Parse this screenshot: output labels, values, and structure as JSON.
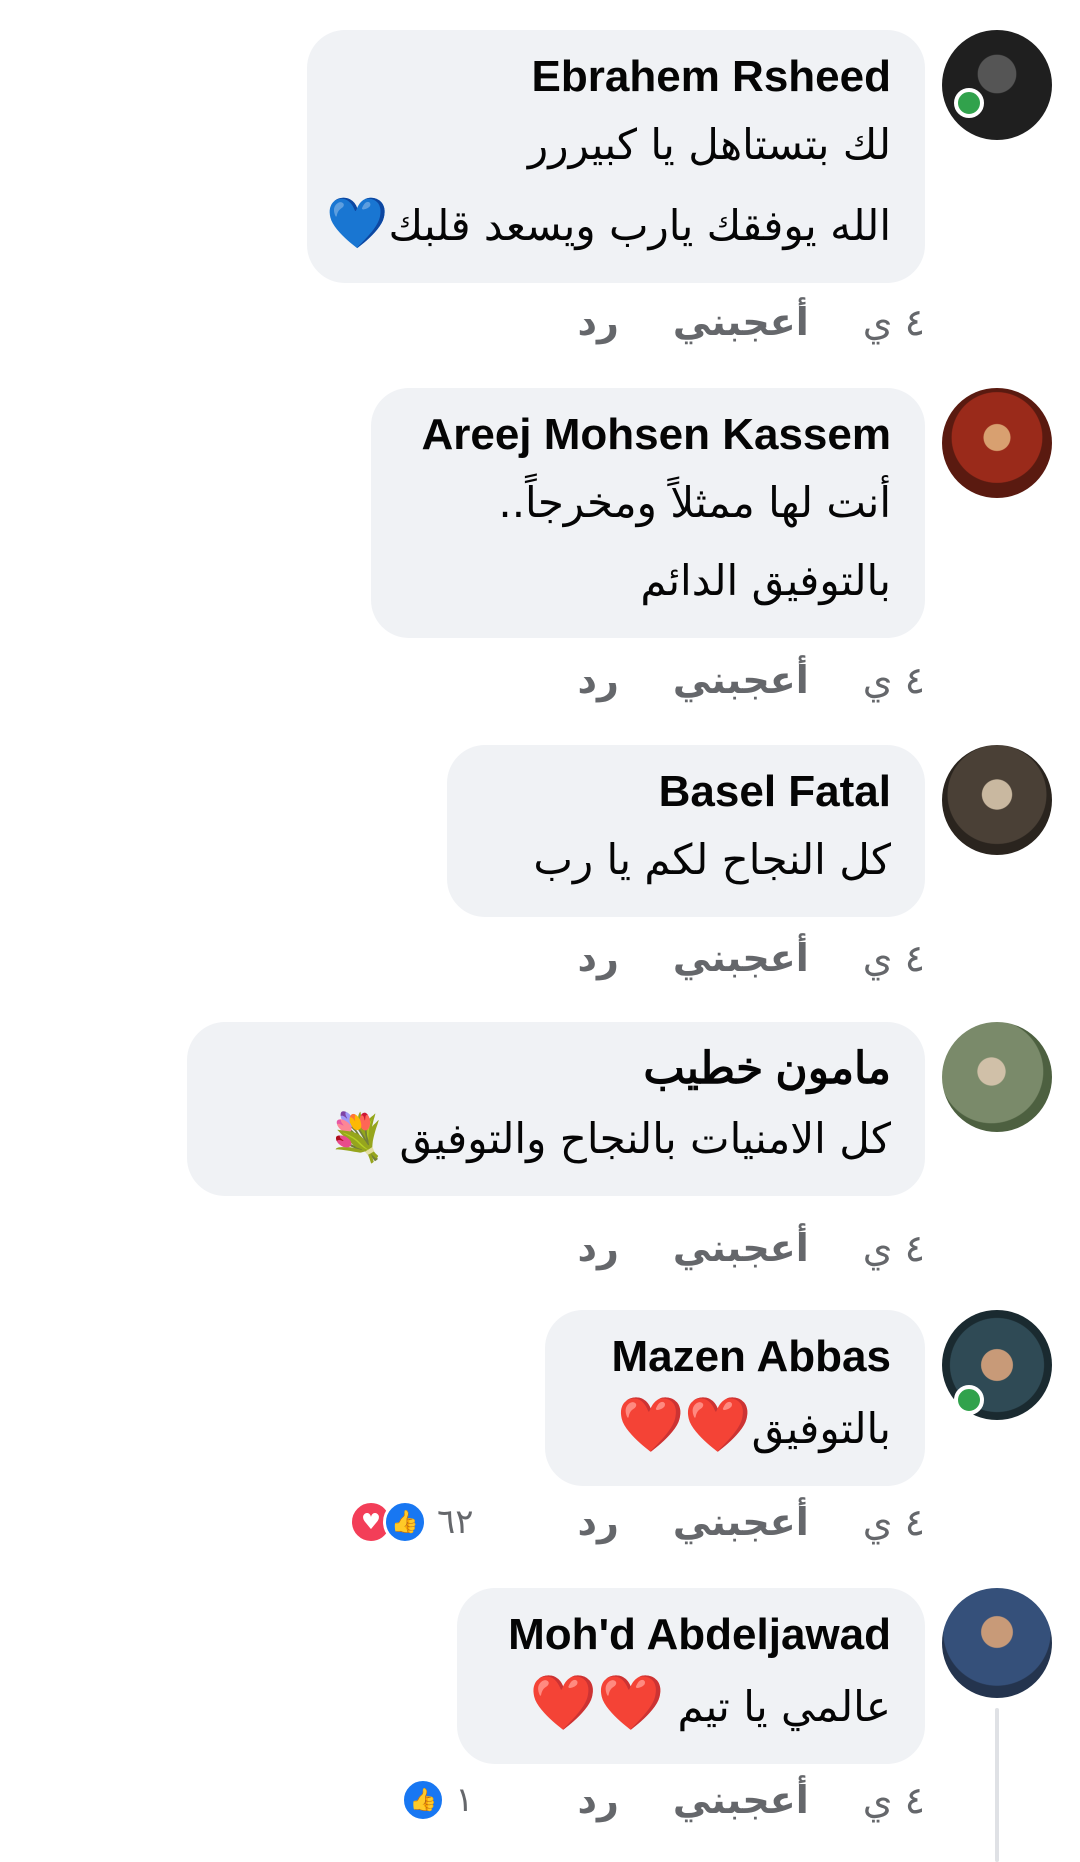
{
  "comments": [
    {
      "name": "Ebrahem Rsheed",
      "lines": [
        "لك بتستاهل يا كبيررر",
        "الله يوفقك يارب ويسعد قلبك"
      ],
      "emoji": "💙",
      "time": "٤ ي",
      "like_label": "أعجبني",
      "reply_label": "رد",
      "online": true,
      "avatar_color": "#2b2b2b"
    },
    {
      "name": "Areej Mohsen Kassem",
      "lines": [
        "أنت لها ممثلاً ومخرجاً..",
        "بالتوفيق الدائم"
      ],
      "time": "٤ ي",
      "like_label": "أعجبني",
      "reply_label": "رد",
      "online": false,
      "avatar_color": "#b23a2a"
    },
    {
      "name": "Basel Fatal",
      "lines": [
        "كل النجاح لكم يا رب"
      ],
      "time": "٤ ي",
      "like_label": "أعجبني",
      "reply_label": "رد",
      "online": false,
      "avatar_color": "#4a4036"
    },
    {
      "name": "مامون خطيب",
      "lines": [
        "كل الامنيات بالنجاح والتوفيق"
      ],
      "emoji": "💐",
      "time": "٤ ي",
      "like_label": "أعجبني",
      "reply_label": "رد",
      "online": false,
      "avatar_color": "#7a8a6a"
    },
    {
      "name": "Mazen Abbas",
      "lines": [
        "بالتوفيق"
      ],
      "emoji": "❤️❤️",
      "time": "٤ ي",
      "like_label": "أعجبني",
      "reply_label": "رد",
      "reaction_count": "٦٢",
      "reactions": [
        "like",
        "love"
      ],
      "online": true,
      "avatar_color": "#2f4a55"
    },
    {
      "name": "Moh'd Abdeljawad",
      "lines": [
        "عالمي يا تيم"
      ],
      "emoji": "❤️❤️",
      "time": "٤ ي",
      "like_label": "أعجبني",
      "reply_label": "رد",
      "reaction_count": "١",
      "reactions": [
        "like"
      ],
      "online": false,
      "avatar_color": "#35507a"
    }
  ],
  "colors": {
    "bubble": "#f0f2f5",
    "online": "#31a24c",
    "like": "#1877f2",
    "love": "#f33e58"
  }
}
